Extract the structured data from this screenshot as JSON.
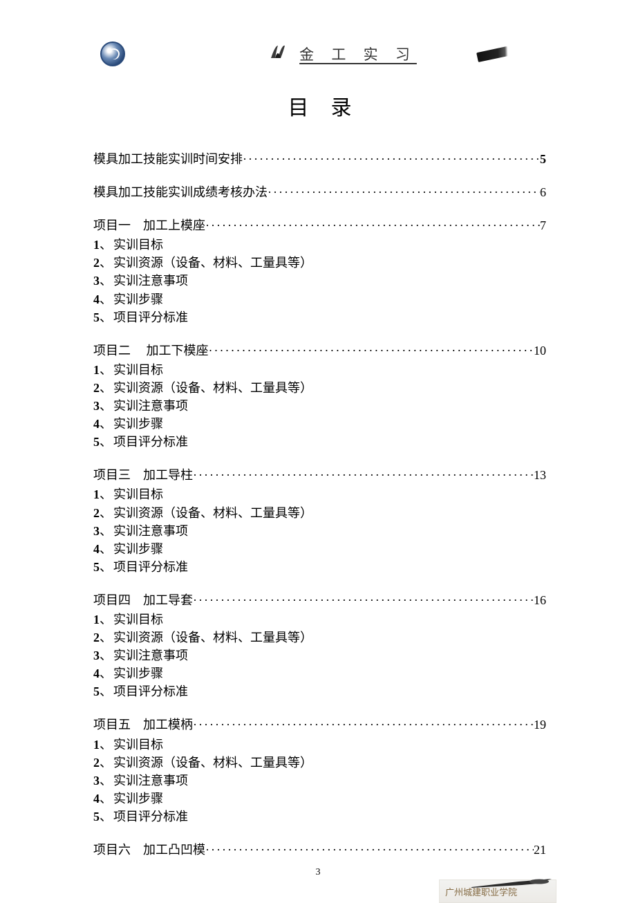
{
  "header": {
    "title": "金 工 实 习"
  },
  "main_title": "目录",
  "toc": {
    "entries": [
      {
        "label": "模具加工技能实训时间安排",
        "page": "5",
        "bold": true
      },
      {
        "label": "模具加工技能实训成绩考核办法",
        "page": "6",
        "bold": false
      }
    ],
    "projects": [
      {
        "label": "项目一　加工上模座",
        "page": "7",
        "bold": false
      },
      {
        "label": "项目二　 加工下模座",
        "page": "10",
        "bold": false
      },
      {
        "label": "项目三　加工导柱",
        "page": "13",
        "bold": false
      },
      {
        "label": "项目四　加工导套",
        "page": "16",
        "bold": false
      },
      {
        "label": "项目五　加工模柄",
        "page": "19",
        "bold": false
      },
      {
        "label": "项目六　加工凸凹模",
        "page": "21",
        "bold": false
      }
    ],
    "sub_items": [
      {
        "num": "1",
        "text": "实训目标"
      },
      {
        "num": "2",
        "text": "实训资源（设备、材料、工量具等）"
      },
      {
        "num": "3",
        "text": "实训注意事项"
      },
      {
        "num": "4",
        "text": "实训步骤"
      },
      {
        "num": "5",
        "text": "项目评分标准"
      }
    ]
  },
  "page_number": "3",
  "footer_text": "广州城建职业学院"
}
